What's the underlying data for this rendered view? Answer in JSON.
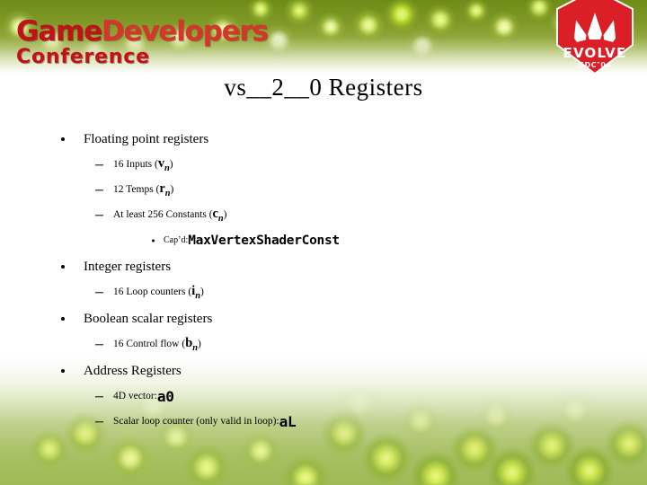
{
  "slide": {
    "title": "vs__2__0 Registers",
    "background": {
      "top_band_color": "#7d9722",
      "bottom_band_color": "#a8c063",
      "body_color": "#ffffff",
      "cell_glow_color": "#dcef6a"
    }
  },
  "gdc_logo": {
    "name": "Game Developers Conference",
    "word_game": "Game",
    "word_developers": "Developers",
    "word_conference": "Conference",
    "color": "#c1121a"
  },
  "evolve_logo": {
    "name": "EVOLVE GDC 2004",
    "wordmark": "EVOLVE",
    "tagline": "GDC‶04",
    "color": "#da1f26"
  },
  "content": [
    {
      "level": 1,
      "text": "Floating point registers",
      "name": "bullet-floating-point-registers"
    },
    {
      "level": 2,
      "name": "bullet-16-inputs",
      "prefix": "16 Inputs (",
      "reg": "v",
      "reg_sub": "n",
      "suffix": ")"
    },
    {
      "level": 2,
      "name": "bullet-12-temps",
      "prefix": "12 Temps (",
      "reg": "r",
      "reg_sub": "n",
      "suffix": ")"
    },
    {
      "level": 2,
      "name": "bullet-256-constants",
      "prefix": "At least 256 Constants (",
      "reg": "c",
      "reg_sub": "n",
      "suffix": ")"
    },
    {
      "level": 3,
      "name": "bullet-capd-maxvertexshaderconst",
      "prefix": "Cap’d: ",
      "code": "MaxVertexShaderConst"
    },
    {
      "level": 1,
      "text": "Integer registers",
      "name": "bullet-integer-registers"
    },
    {
      "level": 2,
      "name": "bullet-16-loop-counters",
      "prefix": "16 Loop counters (",
      "reg": "i",
      "reg_sub": "n",
      "suffix": ")"
    },
    {
      "level": 1,
      "text": "Boolean scalar registers",
      "name": "bullet-boolean-scalar-registers"
    },
    {
      "level": 2,
      "name": "bullet-16-control-flow",
      "prefix": "16 Control flow (",
      "reg": "b",
      "reg_sub": "n",
      "suffix": ")"
    },
    {
      "level": 1,
      "text": "Address Registers",
      "name": "bullet-address-registers"
    },
    {
      "level": 2,
      "name": "bullet-4d-vector-a0",
      "prefix": "4D vector: ",
      "code": "a0"
    },
    {
      "level": 2,
      "name": "bullet-scalar-loop-counter-al",
      "prefix": "Scalar loop counter (only valid in loop): ",
      "code": "aL"
    }
  ]
}
